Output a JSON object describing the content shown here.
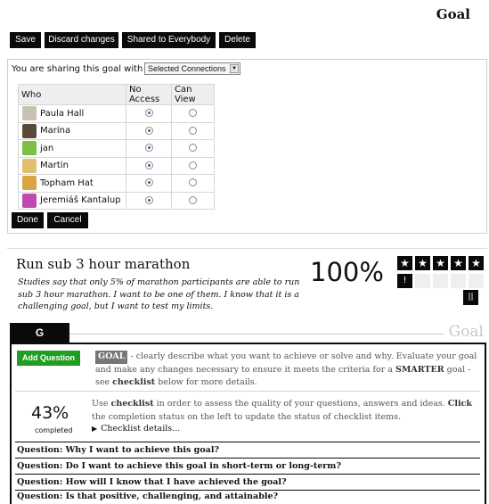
{
  "page": {
    "title": "Goal"
  },
  "toolbar": {
    "save": "Save",
    "discard": "Discard changes",
    "shared": "Shared to Everybody",
    "delete": "Delete"
  },
  "sharing": {
    "prompt": "You are sharing this goal with",
    "select_value": "Selected Connections",
    "columns": {
      "who": "Who",
      "no_access": "No Access",
      "can_view": "Can View"
    },
    "users": [
      {
        "name": "Paula Hall",
        "access": "no_access",
        "avatar_icon": "woman-avatar-icon",
        "avatar_color": "#c8c2b2"
      },
      {
        "name": "Marína",
        "access": "no_access",
        "avatar_icon": "portrait-avatar-icon",
        "avatar_color": "#5a4a3a"
      },
      {
        "name": "jan",
        "access": "no_access",
        "avatar_icon": "pattern-avatar-icon",
        "avatar_color": "#7bc043"
      },
      {
        "name": "Martin",
        "access": "no_access",
        "avatar_icon": "cartoon-avatar-icon",
        "avatar_color": "#e0c070"
      },
      {
        "name": "Topham Hat",
        "access": "no_access",
        "avatar_icon": "hat-avatar-icon",
        "avatar_color": "#d9a441"
      },
      {
        "name": "Jeremiáš Kantalup",
        "access": "no_access",
        "avatar_icon": "pattern-avatar-icon",
        "avatar_color": "#c04ab0"
      }
    ],
    "done": "Done",
    "cancel": "Cancel"
  },
  "goal": {
    "heading": "Run sub 3 hour marathon",
    "description": "Studies say that only 5% of marathon participants are able to run sub 3 hour marathon. I want to be one of them. I know that it is a challenging goal, but I want to test my limits.",
    "progress": "100%",
    "rating": 5,
    "star_glyph": "★",
    "alert_glyph": "!",
    "pause_glyph": "||"
  },
  "tab": {
    "label": "G",
    "section_title": "Goal"
  },
  "panel": {
    "add_question": "Add Question",
    "goal_keyword": "GOAL",
    "goal_text_1": " - clearly describe what you want to achieve or solve and why. Evaluate your goal and make any changes necessary to ensure it meets the criteria for a ",
    "smarter": "SMARTER",
    "goal_text_2": " goal - see ",
    "checklist_word": "checklist",
    "goal_text_3": " below for more details.",
    "completion_pct": "43%",
    "completion_label": "completed",
    "checklist_text_1": "Use ",
    "checklist_text_2": " in order to assess the quality of your questions, answers and ideas. ",
    "click_word": "Click",
    "checklist_text_3": " the completion status on the left to update the status of checklist items.",
    "details_toggle": "Checklist details...",
    "questions": [
      "Question: Why I want to achieve this goal?",
      "Question: Do I want to achieve this goal in short-term or long-term?",
      "Question: How will I know that I have achieved the goal?",
      "Question: Is that positive, challenging, and attainable?"
    ]
  }
}
